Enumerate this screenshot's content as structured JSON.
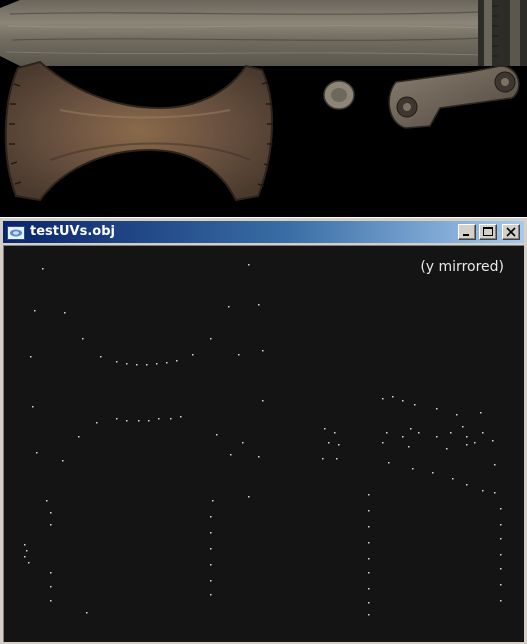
{
  "window": {
    "title": "testUVs.obj",
    "caption": "(y mirrored)",
    "controls": [
      "minimize",
      "maximize",
      "close"
    ],
    "icon": "app-icon"
  },
  "texture_panel": {
    "regions": [
      "wood-plank",
      "axe-head-blade",
      "small-disc",
      "metal-bracket"
    ]
  }
}
